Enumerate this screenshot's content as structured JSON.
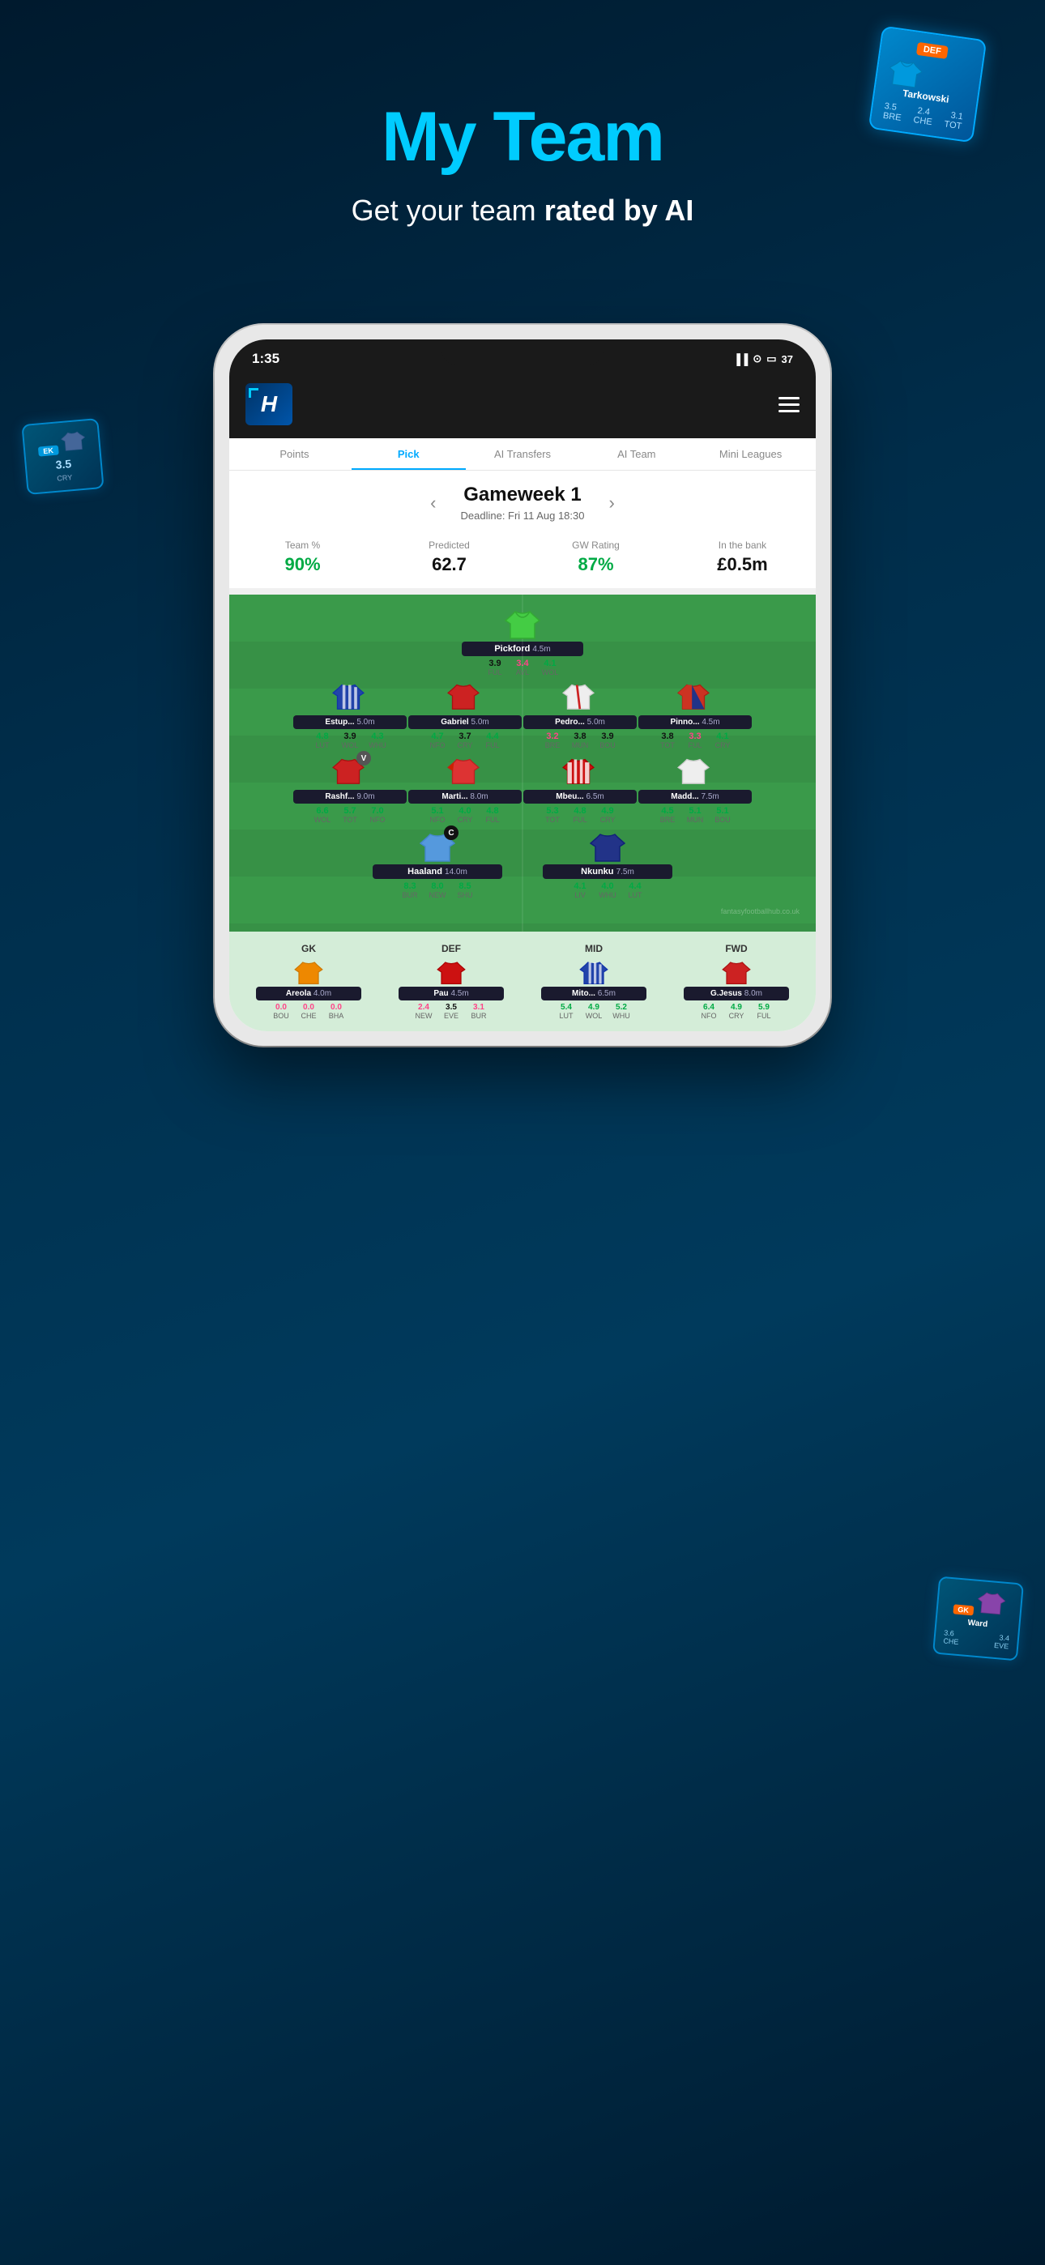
{
  "hero": {
    "title": "My Team",
    "subtitle_normal": "Get your team ",
    "subtitle_bold": "rated by AI"
  },
  "bg_card_top_right": {
    "pos": "DEF",
    "name": "Tarkowski",
    "stats": [
      "3.5",
      "2.4",
      "3.1"
    ],
    "teams": [
      "BRE",
      "CHE",
      "TOT"
    ]
  },
  "bg_card_left": {
    "pos": "EK",
    "stat": "3.5",
    "team": "CRY"
  },
  "bg_card_right": {
    "pos": "GK",
    "name": "Ward",
    "stats": [
      "3.6",
      "3.4"
    ],
    "teams": [
      "CHE",
      "EVE"
    ]
  },
  "status_bar": {
    "time": "1:35",
    "signal": "●● ▲",
    "battery": "37"
  },
  "nav": {
    "tabs": [
      "Points",
      "Pick",
      "AI Transfers",
      "AI Team",
      "Mini Leagues"
    ],
    "active": "Pick"
  },
  "gameweek": {
    "title": "Gameweek 1",
    "deadline": "Deadline: Fri 11 Aug 18:30"
  },
  "stats": {
    "team_pct_label": "Team %",
    "team_pct_value": "90%",
    "predicted_label": "Predicted",
    "predicted_value": "62.7",
    "gw_rating_label": "GW Rating",
    "gw_rating_value": "87%",
    "in_bank_label": "In the bank",
    "in_bank_value": "£0.5m"
  },
  "players": {
    "gk": [
      {
        "name": "Pickford",
        "price": "4.5m",
        "ratings": [
          {
            "num": "3.9",
            "team": "FUL",
            "color": "normal"
          },
          {
            "num": "3.4",
            "team": "AVL",
            "color": "pink"
          },
          {
            "num": "4.1",
            "team": "WOL",
            "color": "green"
          }
        ],
        "jersey_color": "#44bb44",
        "jersey_type": "gk"
      }
    ],
    "def": [
      {
        "name": "Estup...",
        "price": "5.0m",
        "ratings": [
          {
            "num": "4.8",
            "team": "LUT",
            "color": "green"
          },
          {
            "num": "3.9",
            "team": "WOL",
            "color": "normal"
          },
          {
            "num": "4.3",
            "team": "WHU",
            "color": "green"
          }
        ],
        "jersey_type": "def_stripe"
      },
      {
        "name": "Gabriel",
        "price": "5.0m",
        "ratings": [
          {
            "num": "4.7",
            "team": "NFO",
            "color": "green"
          },
          {
            "num": "3.7",
            "team": "CRY",
            "color": "normal"
          },
          {
            "num": "4.4",
            "team": "FUL",
            "color": "green"
          }
        ],
        "jersey_type": "def_red"
      },
      {
        "name": "Pedro...",
        "price": "5.0m",
        "ratings": [
          {
            "num": "3.2",
            "team": "BRE",
            "color": "pink"
          },
          {
            "num": "3.8",
            "team": "MUN",
            "color": "normal"
          },
          {
            "num": "3.9",
            "team": "BOU",
            "color": "normal"
          }
        ],
        "jersey_type": "def_white"
      },
      {
        "name": "Pinno...",
        "price": "4.5m",
        "ratings": [
          {
            "num": "3.8",
            "team": "TOT",
            "color": "normal"
          },
          {
            "num": "3.3",
            "team": "FUL",
            "color": "pink"
          },
          {
            "num": "4.1",
            "team": "CRY",
            "color": "green"
          }
        ],
        "jersey_type": "def_red2"
      }
    ],
    "mid": [
      {
        "name": "Rashf...",
        "price": "9.0m",
        "ratings": [
          {
            "num": "6.6",
            "team": "WOL",
            "color": "green"
          },
          {
            "num": "5.7",
            "team": "TOT",
            "color": "green"
          },
          {
            "num": "7.0",
            "team": "NFO",
            "color": "green"
          }
        ],
        "jersey_type": "mid_red",
        "badge": "v"
      },
      {
        "name": "Marti...",
        "price": "8.0m",
        "ratings": [
          {
            "num": "5.1",
            "team": "NFO",
            "color": "green"
          },
          {
            "num": "4.0",
            "team": "CRY",
            "color": "green"
          },
          {
            "num": "4.8",
            "team": "FUL",
            "color": "green"
          }
        ],
        "jersey_type": "mid_red2"
      },
      {
        "name": "Mbeu...",
        "price": "6.5m",
        "ratings": [
          {
            "num": "5.3",
            "team": "TOT",
            "color": "green"
          },
          {
            "num": "4.8",
            "team": "FUL",
            "color": "green"
          },
          {
            "num": "4.9",
            "team": "CRY",
            "color": "green"
          }
        ],
        "jersey_type": "mid_stripe"
      },
      {
        "name": "Madd...",
        "price": "7.5m",
        "ratings": [
          {
            "num": "4.5",
            "team": "BRE",
            "color": "green"
          },
          {
            "num": "5.1",
            "team": "MUN",
            "color": "green"
          },
          {
            "num": "5.1",
            "team": "BOU",
            "color": "green"
          }
        ],
        "jersey_type": "mid_white"
      }
    ],
    "fwd": [
      {
        "name": "Haaland",
        "price": "14.0m",
        "ratings": [
          {
            "num": "8.3",
            "team": "BUR",
            "color": "green"
          },
          {
            "num": "8.0",
            "team": "NEW",
            "color": "green"
          },
          {
            "num": "8.5",
            "team": "SHU",
            "color": "green"
          }
        ],
        "jersey_type": "fwd_blue",
        "badge": "c"
      },
      {
        "name": "Nkunku",
        "price": "7.5m",
        "ratings": [
          {
            "num": "4.1",
            "team": "LIV",
            "color": "green"
          },
          {
            "num": "4.0",
            "team": "WHU",
            "color": "green"
          },
          {
            "num": "4.4",
            "team": "LUT",
            "color": "green"
          }
        ],
        "jersey_type": "fwd_blue2"
      }
    ],
    "bench": [
      {
        "pos": "GK",
        "name": "Areola",
        "price": "4.0m",
        "ratings": [
          {
            "num": "0.0",
            "team": "BOU",
            "color": "normal"
          },
          {
            "num": "0.0",
            "team": "CHE",
            "color": "normal"
          },
          {
            "num": "0.0",
            "team": "BHA",
            "color": "normal"
          }
        ],
        "jersey_type": "bench_gk"
      },
      {
        "pos": "DEF",
        "name": "Pau",
        "price": "4.5m",
        "ratings": [
          {
            "num": "2.4",
            "team": "NEW",
            "color": "pink"
          },
          {
            "num": "3.5",
            "team": "EVE",
            "color": "normal"
          },
          {
            "num": "3.1",
            "team": "BUR",
            "color": "pink"
          }
        ],
        "jersey_type": "bench_def"
      },
      {
        "pos": "MID",
        "name": "Mito...",
        "price": "6.5m",
        "ratings": [
          {
            "num": "5.4",
            "team": "LUT",
            "color": "green"
          },
          {
            "num": "4.9",
            "team": "WOL",
            "color": "green"
          },
          {
            "num": "5.2",
            "team": "WHU",
            "color": "green"
          }
        ],
        "jersey_type": "bench_mid"
      },
      {
        "pos": "FWD",
        "name": "G.Jesus",
        "price": "8.0m",
        "ratings": [
          {
            "num": "6.4",
            "team": "NFO",
            "color": "green"
          },
          {
            "num": "4.9",
            "team": "CRY",
            "color": "green"
          },
          {
            "num": "5.9",
            "team": "FUL",
            "color": "green"
          }
        ],
        "jersey_type": "bench_fwd"
      }
    ]
  },
  "watermark": "fantasyfootballhub.co.uk"
}
